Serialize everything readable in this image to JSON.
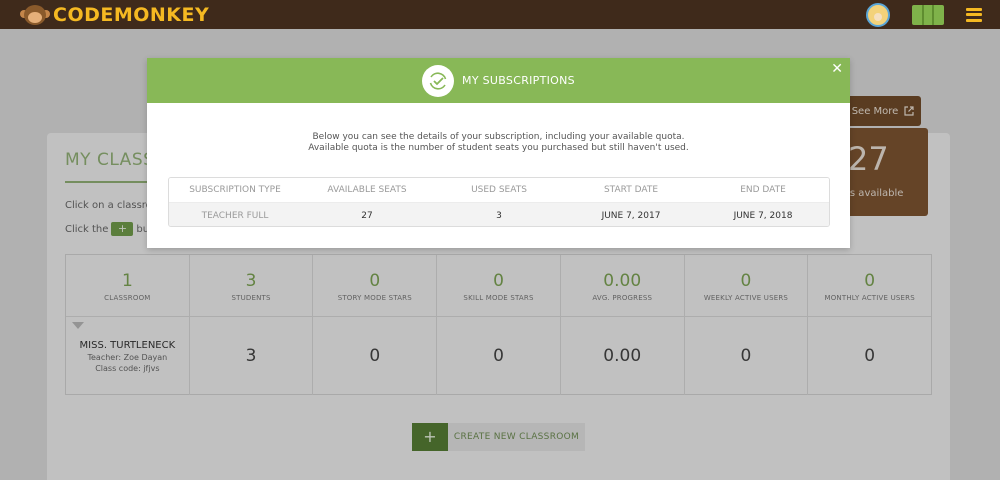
{
  "app": {
    "logo_text": "CodeMonkey"
  },
  "background": {
    "card_title": "MY CLASS",
    "instructions": [
      "Click on a classroom",
      "Click the",
      "butt"
    ],
    "see_more_label": "See More",
    "seats_available_number": "27",
    "seats_available_label": "ts available",
    "stats": [
      {
        "value": "1",
        "label": "CLASSROOM"
      },
      {
        "value": "3",
        "label": "STUDENTS"
      },
      {
        "value": "0",
        "label": "STORY MODE STARS"
      },
      {
        "value": "0",
        "label": "SKILL MODE STARS"
      },
      {
        "value": "0.00",
        "label": "AVG. PROGRESS"
      },
      {
        "value": "0",
        "label": "WEEKLY ACTIVE USERS"
      },
      {
        "value": "0",
        "label": "MONTHLY ACTIVE USERS"
      }
    ],
    "classroom_row": {
      "name": "MISS. TURTLENECK",
      "teacher": "Teacher: Zoe Dayan",
      "class_code": "Class code: jfjvs",
      "students": "3",
      "story_stars": "0",
      "skill_stars": "0",
      "avg_progress": "0.00",
      "weekly_active": "0",
      "monthly_active": "0"
    },
    "create_button_label": "CREATE NEW CLASSROOM"
  },
  "modal": {
    "title": "MY SUBSCRIPTIONS",
    "description_line1": "Below you can see the details of your subscription, including your available quota.",
    "description_line2": "Available quota is the number of student seats you purchased but still haven't used.",
    "table": {
      "headers": [
        "SUBSCRIPTION TYPE",
        "AVAILABLE SEATS",
        "USED SEATS",
        "START DATE",
        "END DATE"
      ],
      "row": [
        "TEACHER FULL",
        "27",
        "3",
        "JUNE 7, 2017",
        "JUNE 7, 2018"
      ]
    }
  },
  "colors": {
    "header_brown": "#3f2a1b",
    "accent_green": "#88b857",
    "logo_yellow": "#f5b922"
  }
}
